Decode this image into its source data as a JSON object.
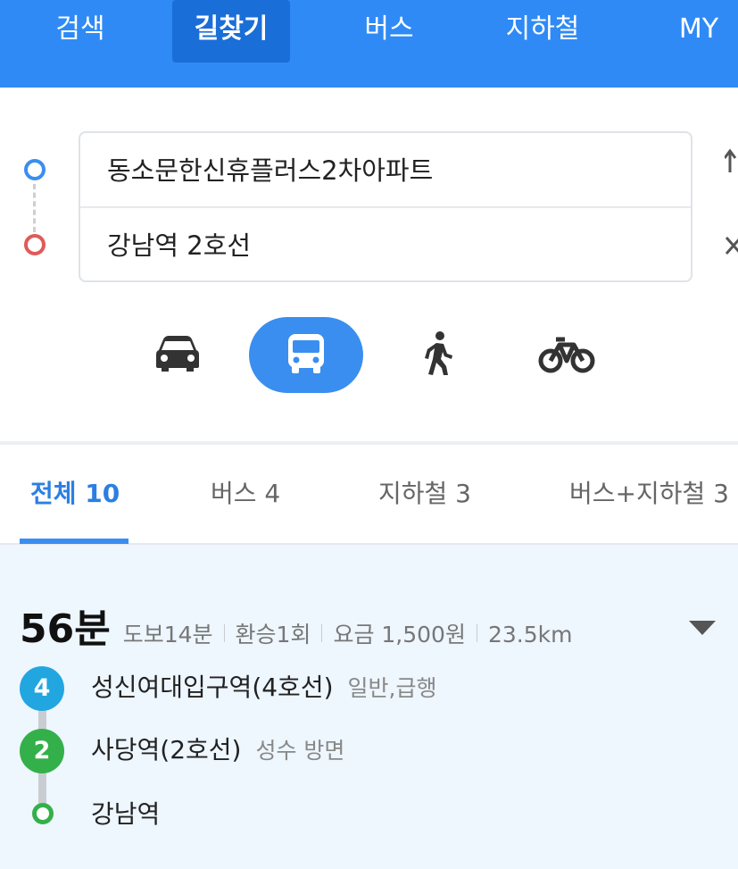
{
  "nav": {
    "items": [
      "검색",
      "길찾기",
      "버스",
      "지하철",
      "MY"
    ],
    "active_index": 1
  },
  "route": {
    "origin": "동소문한신휴플러스2차아파트",
    "destination": "강남역 2호선"
  },
  "modes": [
    {
      "icon": "car-icon",
      "active": false
    },
    {
      "icon": "bus-icon",
      "active": true
    },
    {
      "icon": "walk-icon",
      "active": false
    },
    {
      "icon": "bicycle-icon",
      "active": false
    }
  ],
  "tabs": [
    {
      "label": "전체 10",
      "active": true
    },
    {
      "label": "버스 4",
      "active": false
    },
    {
      "label": "지하철 3",
      "active": false
    },
    {
      "label": "버스+지하철 3",
      "active": false
    }
  ],
  "result": {
    "duration": "56분",
    "walk": "도보14분",
    "transfer": "환승1회",
    "fare": "요금 1,500원",
    "distance": "23.5km",
    "steps": [
      {
        "badge": "4",
        "color": "#21a6e0",
        "station": "성신여대입구역(4호선)",
        "detail": "일반,급행"
      },
      {
        "badge": "2",
        "color": "#34b04a",
        "station": "사당역(2호선)",
        "detail": "성수 방면"
      },
      {
        "badge": "",
        "color": "#34b04a",
        "station": "강남역",
        "detail": ""
      }
    ]
  },
  "colors": {
    "nav_bg": "#2f8af5",
    "accent": "#3a8ef0",
    "panel_bg": "#eef6fe"
  }
}
